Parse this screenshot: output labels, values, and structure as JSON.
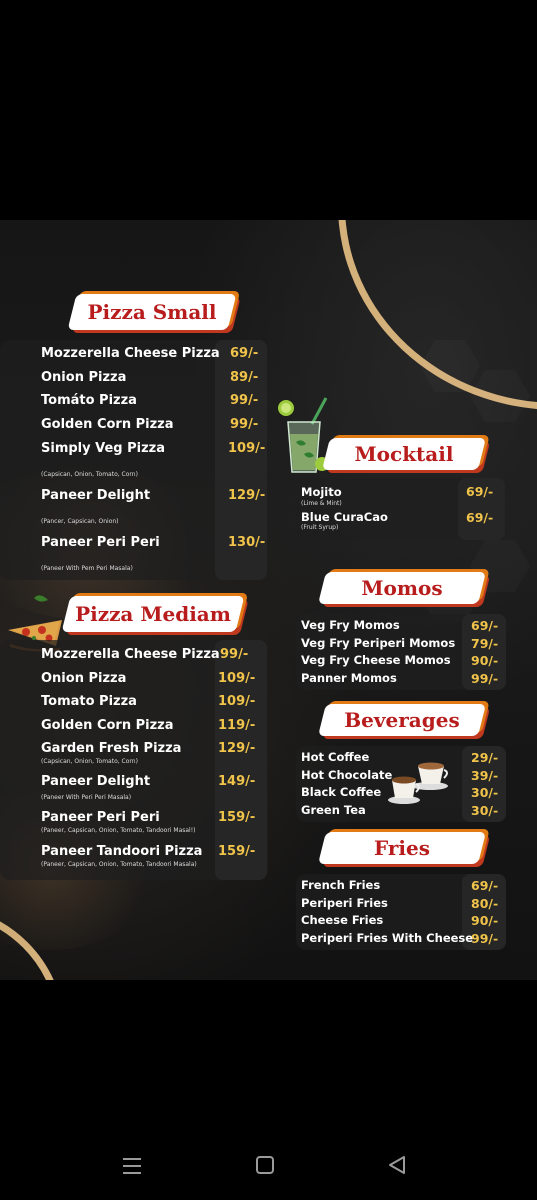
{
  "pizza_small": {
    "title": "Pizza Small",
    "items": [
      {
        "name": "Mozzerella Cheese Pizza",
        "price": "69/-"
      },
      {
        "name": "Onion Pizza",
        "price": "89/-"
      },
      {
        "name": "Tomáto Pizza",
        "price": "99/-"
      },
      {
        "name": "Golden Corn Pizza",
        "price": "99/-"
      },
      {
        "name": "Simply Veg Pizza",
        "price": "109/-",
        "desc": "(Capsican, Onion, Tomato, Corn)"
      },
      {
        "name": "Paneer Delight",
        "price": "129/-",
        "desc": "(Pancer, Capsican, Onion)"
      },
      {
        "name": "Paneer Peri Peri",
        "price": "130/-",
        "desc": "(Paneer With Pem Peri Masala)"
      }
    ]
  },
  "pizza_medium": {
    "title": "Pizza Mediam",
    "items": [
      {
        "name": "Mozzerella Cheese Pizza",
        "price": "99/-"
      },
      {
        "name": "Onion Pizza",
        "price": "109/-"
      },
      {
        "name": "Tomato Pizza",
        "price": "109/-"
      },
      {
        "name": "Golden Corn Pizza",
        "price": "119/-"
      },
      {
        "name": "Garden Fresh Pizza",
        "price": "129/-",
        "desc": "(Capsican, Onion, Tomato, Corn)"
      },
      {
        "name": "Paneer Delight",
        "price": "149/-",
        "desc": "(Paneer With Peri Peri Masala)"
      },
      {
        "name": "Paneer Peri Peri",
        "price": "159/-",
        "desc": "(Paneer, Capsican, Onion, Tomato, Tandoori Masal!)"
      },
      {
        "name": "Paneer Tandoori Pizza",
        "price": "159/-",
        "desc": "(Paneer, Capsican, Onion, Tomato, Tandoori Masala)"
      }
    ]
  },
  "mocktail": {
    "title": "Mocktail",
    "items": [
      {
        "name": "Mojito",
        "price": "69/-",
        "desc": "(Lime & Mint)"
      },
      {
        "name": "Blue CuraCao",
        "price": "69/-",
        "desc": "(Fruit Syrup)"
      }
    ]
  },
  "momos": {
    "title": "Momos",
    "items": [
      {
        "name": "Veg Fry Momos",
        "price": "69/-"
      },
      {
        "name": "Veg Fry Periperi Momos",
        "price": "79/-"
      },
      {
        "name": "Veg Fry Cheese Momos",
        "price": "90/-"
      },
      {
        "name": "Panner Momos",
        "price": "99/-"
      }
    ]
  },
  "beverages": {
    "title": "Beverages",
    "items": [
      {
        "name": "Hot Coffee",
        "price": "29/-"
      },
      {
        "name": "Hot Chocolate",
        "price": "39/-"
      },
      {
        "name": "Black Coffee",
        "price": "30/-"
      },
      {
        "name": "Green Tea",
        "price": "30/-"
      }
    ]
  },
  "fries": {
    "title": "Fries",
    "items": [
      {
        "name": "French Fries",
        "price": "69/-"
      },
      {
        "name": "Periperi Fries",
        "price": "80/-"
      },
      {
        "name": "Cheese Fries",
        "price": "90/-"
      },
      {
        "name": "Periperi Fries With Cheese",
        "price": "99/-"
      }
    ]
  },
  "colors": {
    "accent": "#f0c34a",
    "banner_text": "#b81c1c",
    "arc": "#d4b07a",
    "background": "#000000"
  },
  "icons": [
    "mocktail-glass-icon",
    "pizza-icon",
    "coffee-cups-icon",
    "nav-recents-icon",
    "nav-home-icon",
    "nav-back-icon"
  ]
}
